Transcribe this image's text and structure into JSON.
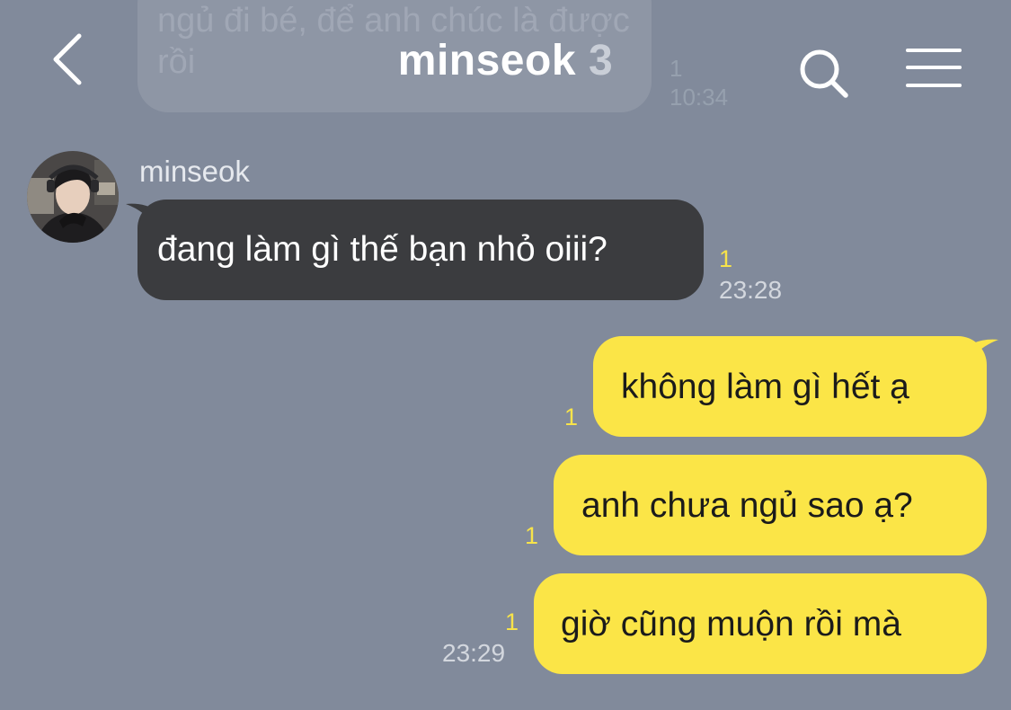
{
  "colors": {
    "background": "#818a9b",
    "incoming_bubble": "#3b3c3f",
    "outgoing_bubble": "#fbe547",
    "unread_count": "#f7e34a"
  },
  "header": {
    "title": "minseok",
    "member_count": "3",
    "back_icon": "chevron-left-icon",
    "search_icon": "search-icon",
    "menu_icon": "hamburger-menu-icon"
  },
  "faded_message": {
    "text": "ngủ đi bé, để anh chúc là được rồi",
    "unread": "1",
    "time": "10:34"
  },
  "messages": [
    {
      "direction": "incoming",
      "sender": "minseok",
      "text": "đang làm gì thế bạn nhỏ oiii?",
      "unread": "1",
      "time": "23:28"
    },
    {
      "direction": "outgoing",
      "text": "không làm gì hết ạ",
      "unread": "1",
      "time": ""
    },
    {
      "direction": "outgoing",
      "text": "anh chưa ngủ sao ạ?",
      "unread": "1",
      "time": ""
    },
    {
      "direction": "outgoing",
      "text": "giờ cũng muộn rồi mà",
      "unread": "1",
      "time": "23:29"
    }
  ]
}
